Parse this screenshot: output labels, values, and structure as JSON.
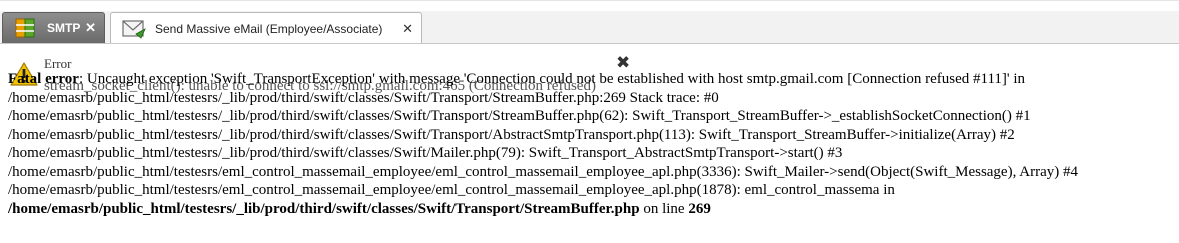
{
  "tabs": [
    {
      "label": "SMTP",
      "icon": "database-icon",
      "close": "✕",
      "active": false
    },
    {
      "label": "Send Massive eMail (Employee/Associate)",
      "icon": "send-mail-icon",
      "close": "✕",
      "active": true
    }
  ],
  "dialog": {
    "title": "Error",
    "close_glyph": "✖",
    "message": "stream_socket_client(): unable to connect to ssl://smtp.gmail.com:465 (Connection refused)"
  },
  "error": {
    "label": "Fatal error",
    "text": ": Uncaught exception 'Swift_TransportException' with message 'Connection could not be established with host smtp.gmail.com [Connection refused #111]' in /home/emasrb/public_html/testesrs/_lib/prod/third/swift/classes/Swift/Transport/StreamBuffer.php:269 Stack trace: #0 /home/emasrb/public_html/testesrs/_lib/prod/third/swift/classes/Swift/Transport/StreamBuffer.php(62): Swift_Transport_StreamBuffer->_establishSocketConnection() #1 /home/emasrb/public_html/testesrs/_lib/prod/third/swift/classes/Swift/Transport/AbstractSmtpTransport.php(113): Swift_Transport_StreamBuffer->initialize(Array) #2 /home/emasrb/public_html/testesrs/_lib/prod/third/swift/classes/Swift/Mailer.php(79): Swift_Transport_AbstractSmtpTransport->start() #3 /home/emasrb/public_html/testesrs/eml_control_massemail_employee/eml_control_massemail_employee_apl.php(3336): Swift_Mailer->send(Object(Swift_Message), Array) #4 /home/emasrb/public_html/testesrs/eml_control_massemail_employee/eml_control_massemail_employee_apl.php(1878): eml_control_massema in ",
    "file": "/home/emasrb/public_html/testesrs/_lib/prod/third/swift/classes/Swift/Transport/StreamBuffer.php",
    "on_line_text": " on line ",
    "line": "269"
  },
  "colors": {
    "active_tab_bg": "#ffffff",
    "inactive_tab_bg": "#7d7d7d",
    "warning": "#f2c200"
  }
}
